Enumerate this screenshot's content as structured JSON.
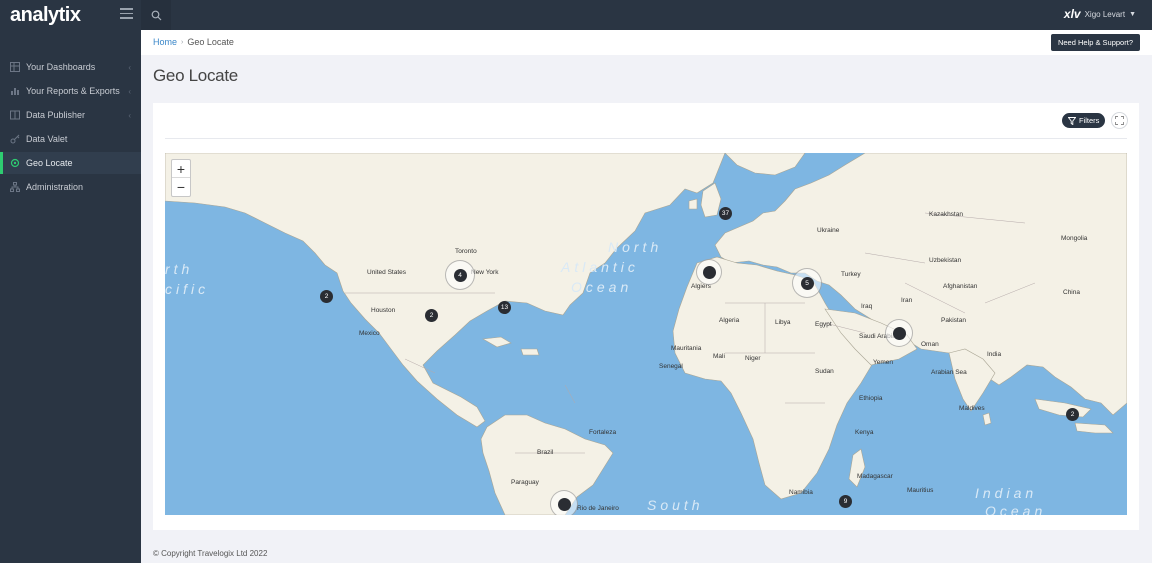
{
  "app": {
    "logo_text": "analytix"
  },
  "topbar": {
    "user_initials": "xlv",
    "user_name": "Xigo Levart",
    "help_label": "Need Help & Support?"
  },
  "sidebar": {
    "items": [
      {
        "label": "Your Dashboards",
        "icon": "table-icon",
        "has_chevron": true
      },
      {
        "label": "Your Reports & Exports",
        "icon": "bar-chart-icon",
        "has_chevron": true
      },
      {
        "label": "Data Publisher",
        "icon": "book-icon",
        "has_chevron": true
      },
      {
        "label": "Data Valet",
        "icon": "key-icon",
        "has_chevron": false
      },
      {
        "label": "Geo Locate",
        "icon": "map-pin-icon",
        "has_chevron": false,
        "active": true
      },
      {
        "label": "Administration",
        "icon": "sitemap-icon",
        "has_chevron": false
      }
    ]
  },
  "breadcrumb": {
    "home": "Home",
    "current": "Geo Locate"
  },
  "page": {
    "title": "Geo Locate"
  },
  "card": {
    "filters_label": "Filters"
  },
  "map": {
    "zoom_in": "+",
    "zoom_out": "−",
    "oceans": {
      "north": "North",
      "atlantic": "Atlantic",
      "ocean_north": "Ocean",
      "south": "South",
      "indian": "Indian",
      "ocean_indian": "Ocean",
      "pacific_1": "rth",
      "pacific_2": "cific"
    },
    "places": {
      "united_states": "United States",
      "houston": "Houston",
      "mexico": "Mexico",
      "toronto": "Toronto",
      "new_york": "New York",
      "algiers": "Algiers",
      "algeria": "Algeria",
      "libya": "Libya",
      "egypt": "Egypt",
      "mauritania": "Mauritania",
      "mali": "Mali",
      "niger": "Niger",
      "senegal": "Senegal",
      "sudan": "Sudan",
      "ethiopia": "Ethiopia",
      "kenya": "Kenya",
      "namibia": "Namibia",
      "madagascar": "Madagascar",
      "mauritius": "Mauritius",
      "brazil": "Brazil",
      "paraguay": "Paraguay",
      "rio": "Rio de Janeiro",
      "fortaleza": "Fortaleza",
      "ukraine": "Ukraine",
      "turkey": "Turkey",
      "iran": "Iran",
      "iraq": "Iraq",
      "saudi": "Saudi Arabia",
      "yemen": "Yemen",
      "oman": "Oman",
      "kazakhstan": "Kazakhstan",
      "uzbekistan": "Uzbekistan",
      "afghanistan": "Afghanistan",
      "pakistan": "Pakistan",
      "india": "India",
      "china": "China",
      "mongolia": "Mongolia",
      "maldives": "Maldives",
      "arabian_sea": "Arabian Sea"
    },
    "clusters": [
      {
        "id": "uk",
        "count": "37"
      },
      {
        "id": "algiers",
        "count": ""
      },
      {
        "id": "turkey",
        "count": "5"
      },
      {
        "id": "gulf",
        "count": ""
      },
      {
        "id": "new-york",
        "count": "4"
      },
      {
        "id": "west-us",
        "count": "2"
      },
      {
        "id": "florida",
        "count": "2"
      },
      {
        "id": "atlantic",
        "count": "13"
      },
      {
        "id": "south-asia",
        "count": "2"
      },
      {
        "id": "south-africa",
        "count": "9"
      },
      {
        "id": "rio",
        "count": ""
      }
    ]
  },
  "footer": {
    "copyright": "© Copyright Travelogix Ltd 2022"
  }
}
